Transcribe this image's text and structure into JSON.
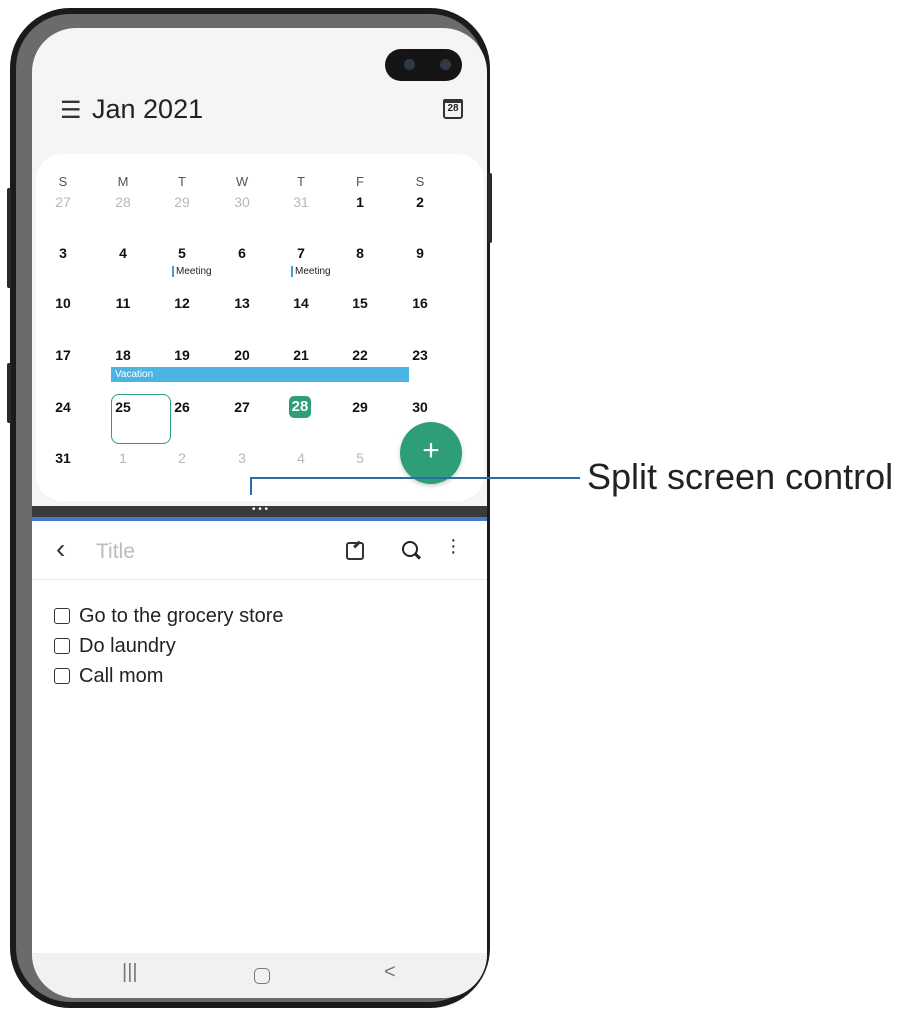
{
  "calendar": {
    "month_label": "Jan 2021",
    "today_icon_number": "28",
    "weekdays": [
      "S",
      "M",
      "T",
      "W",
      "T",
      "F",
      "S"
    ],
    "weeks": [
      [
        "27",
        "28",
        "29",
        "30",
        "31",
        "1",
        "2"
      ],
      [
        "3",
        "4",
        "5",
        "6",
        "7",
        "8",
        "9"
      ],
      [
        "10",
        "11",
        "12",
        "13",
        "14",
        "15",
        "16"
      ],
      [
        "17",
        "18",
        "19",
        "20",
        "21",
        "22",
        "23"
      ],
      [
        "24",
        "25",
        "26",
        "27",
        "28",
        "29",
        "30"
      ],
      [
        "31",
        "1",
        "2",
        "3",
        "4",
        "5",
        ""
      ]
    ],
    "event_meeting_5": "Meeting",
    "event_meeting_7": "Meeting",
    "event_vacation": "Vacation",
    "fab_symbol": "+",
    "accent_color": "#2e9e78",
    "event_color": "#4ab5e3"
  },
  "notes": {
    "title_placeholder": "Title",
    "items": [
      "Go to the grocery store",
      "Do laundry",
      "Call mom"
    ]
  },
  "split_control": {
    "dots": "• • •",
    "callout_label": "Split screen control",
    "bar_accent_color": "#4a78c9"
  },
  "navbar": {
    "recents_symbol": "|||",
    "back_symbol": "<"
  }
}
